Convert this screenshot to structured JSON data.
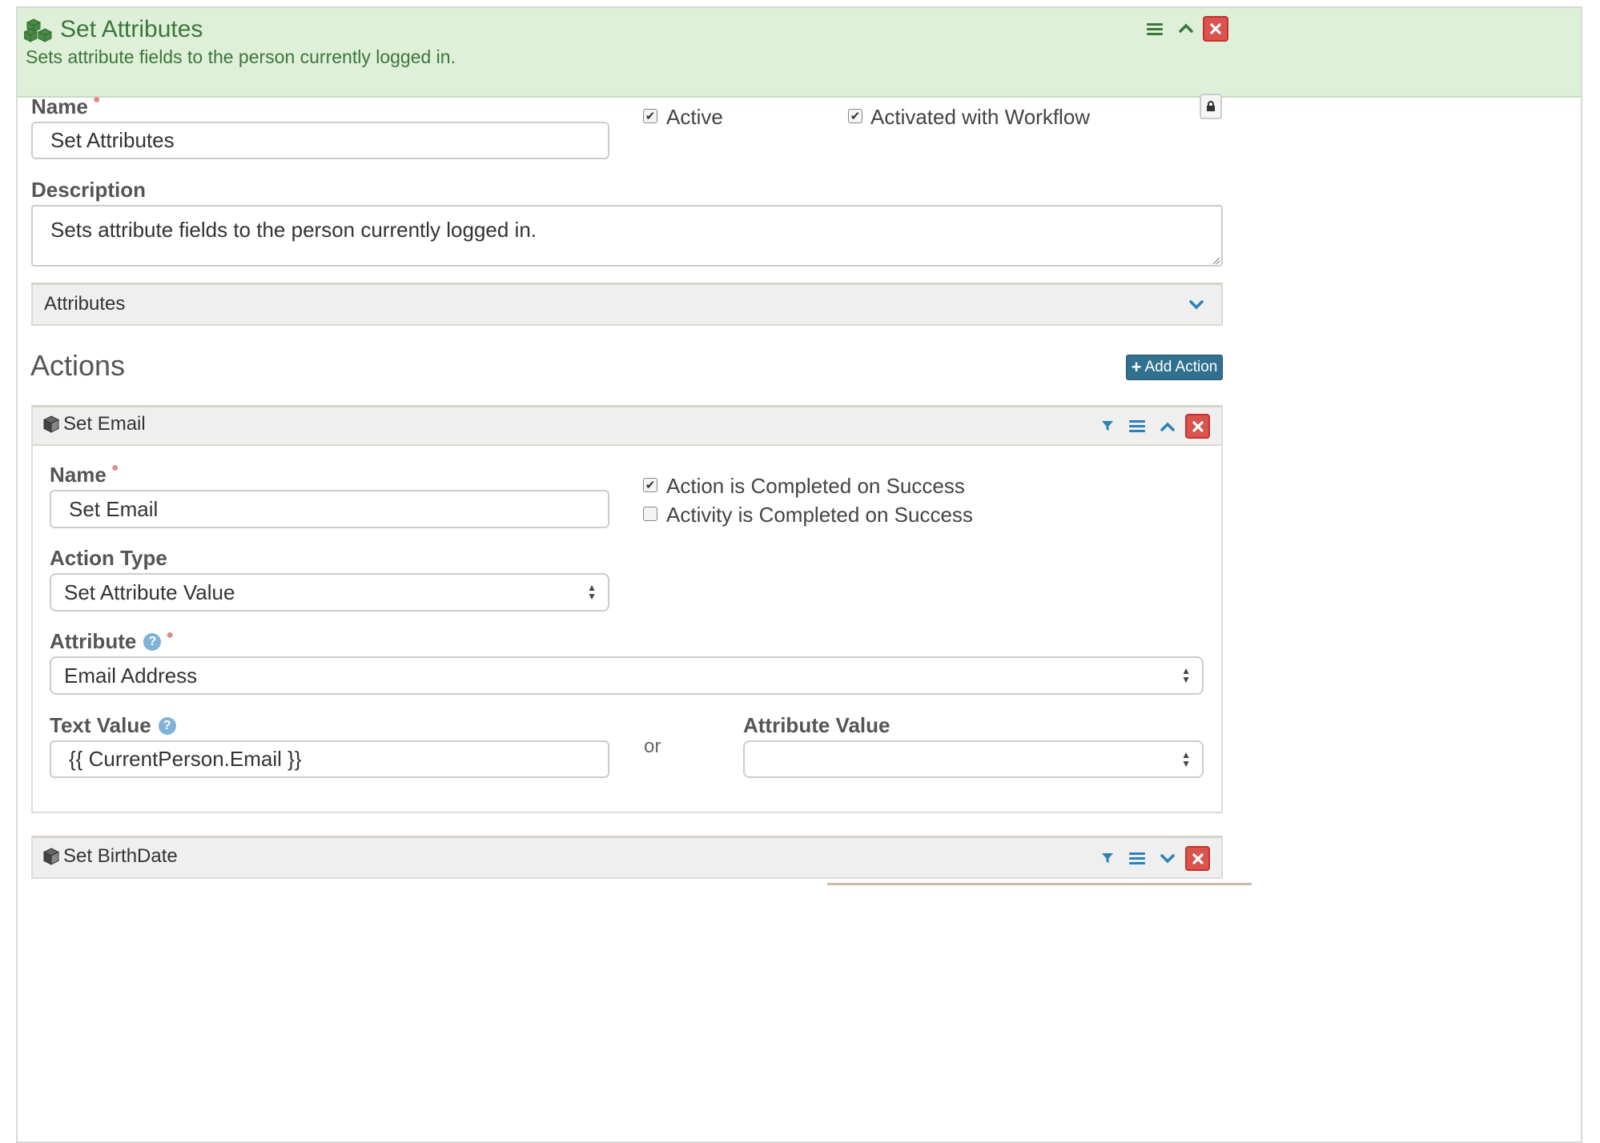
{
  "panel": {
    "title": "Set Attributes",
    "subtitle": "Sets attribute fields to the person currently logged in."
  },
  "activity_form": {
    "name_label": "Name",
    "name_value": "Set Attributes",
    "active_label": "Active",
    "active_checked": true,
    "activated_label": "Activated with Workflow",
    "activated_checked": true,
    "description_label": "Description",
    "description_value": "Sets attribute fields to the person currently logged in."
  },
  "attributes_section": {
    "label": "Attributes"
  },
  "actions": {
    "heading": "Actions",
    "add_button": "Add Action",
    "items": [
      {
        "title": "Set Email",
        "expanded": true,
        "name_label": "Name",
        "name_value": "Set Email",
        "completed_action_label": "Action is Completed on Success",
        "completed_action_checked": true,
        "completed_activity_label": "Activity is Completed on Success",
        "completed_activity_checked": false,
        "action_type_label": "Action Type",
        "action_type_value": "Set Attribute Value",
        "attribute_label": "Attribute",
        "attribute_value": "Email Address",
        "text_value_label": "Text Value",
        "text_value": "{{ CurrentPerson.Email }}",
        "or_label": "or",
        "attribute_value_label": "Attribute Value",
        "attribute_value_selected": ""
      },
      {
        "title": "Set BirthDate",
        "expanded": false
      }
    ]
  },
  "colors": {
    "header_green_bg": "#dff0d8",
    "header_green_text": "#3c763d",
    "danger": "#d9534f",
    "primary_dark": "#31708f",
    "icon_blue": "#2c82b8"
  },
  "icons": {
    "panel": "cubes-icon",
    "action": "cube-icon",
    "menu": "bars-icon",
    "collapse": "chevron-up-icon",
    "expand": "chevron-down-icon",
    "close": "close-icon",
    "filter": "filter-icon",
    "lock": "lock-icon",
    "help": "question-circle-icon",
    "plus": "plus-icon"
  }
}
